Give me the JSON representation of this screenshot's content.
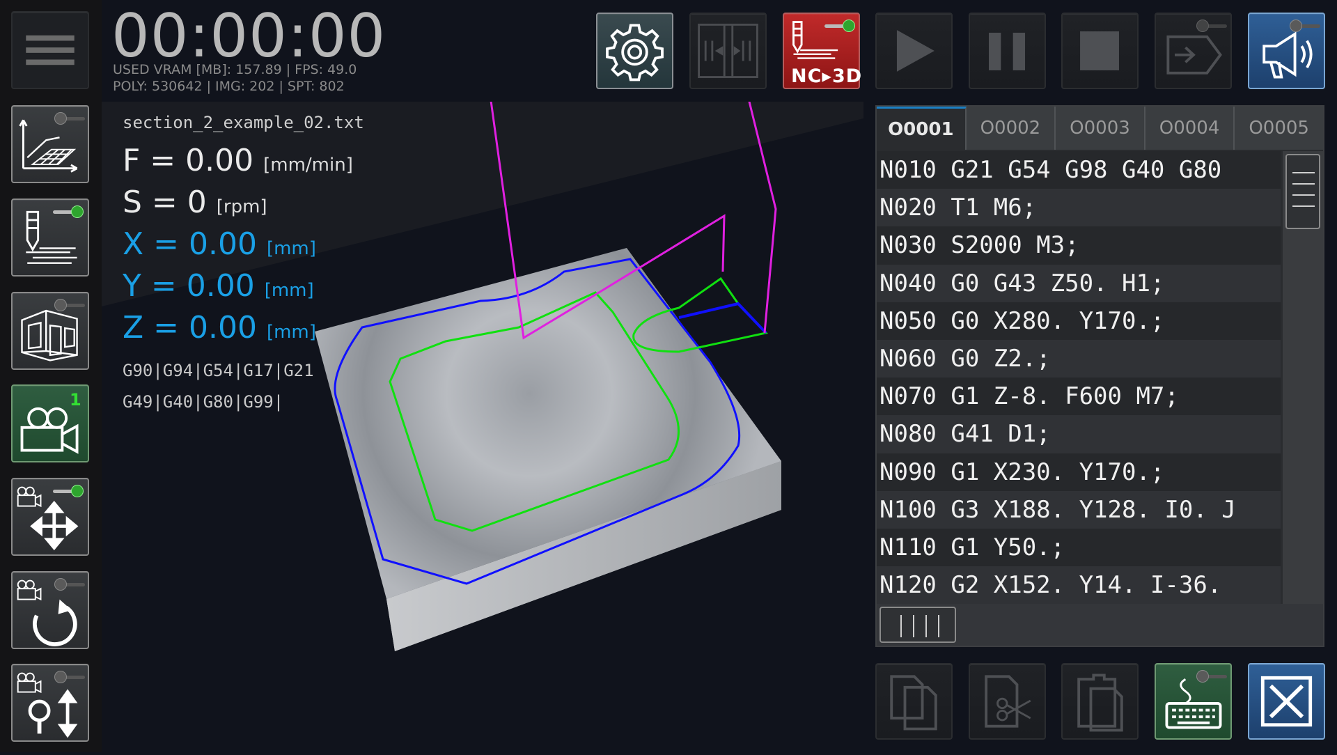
{
  "timer": "00:00:00",
  "stats": {
    "line1": "USED VRAM [MB]: 157.89 | FPS: 49.0",
    "line2": "POLY: 530642 | IMG: 202 | SPT: 802"
  },
  "file_name": "section_2_example_02.txt",
  "readouts": {
    "f": {
      "label": "F = 0.00",
      "unit": "[mm/min]"
    },
    "s": {
      "label": "S = 0",
      "unit": "[rpm]"
    },
    "x": {
      "label": "X = 0.00",
      "unit": "[mm]"
    },
    "y": {
      "label": "Y = 0.00",
      "unit": "[mm]"
    },
    "z": {
      "label": "Z = 0.00",
      "unit": "[mm]"
    }
  },
  "modal_codes": {
    "line1": "G90|G94|G54|G17|G21",
    "line2": "G49|G40|G80|G99|"
  },
  "toolbar": {
    "nc3d_label": "NC▸3D"
  },
  "camera_badge": "1",
  "editor": {
    "tabs": [
      "O0001",
      "O0002",
      "O0003",
      "O0004",
      "O0005"
    ],
    "active_tab": "O0001",
    "lines": [
      "N010 G21 G54 G98 G40 G80",
      "N020 T1 M6;",
      "N030 S2000 M3;",
      "N040 G0 G43 Z50. H1;",
      "N050 G0 X280. Y170.;",
      "N060 G0 Z2.;",
      "N070 G1 Z-8. F600 M7;",
      "N080 G41 D1;",
      "N090 G1 X230. Y170.;",
      "N100 G3 X188. Y128. I0. J",
      "N110 G1 Y50.;",
      "N120 G2 X152. Y14. I-36."
    ]
  },
  "colors": {
    "toolpath_rapid": "#e020e0",
    "toolpath_contour": "#1010ff",
    "toolpath_cut": "#10e010",
    "axis_blue": "#1aa0e6",
    "stop_red": "#c02a2a"
  }
}
